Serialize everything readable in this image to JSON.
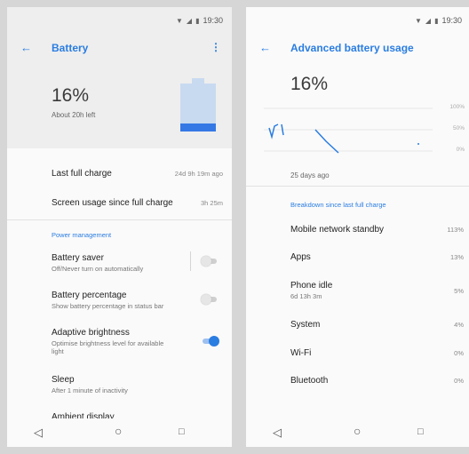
{
  "status": {
    "time": "19:30"
  },
  "left": {
    "title": "Battery",
    "percent": "16%",
    "time_left": "About 20h left",
    "battery_level": 0.16,
    "last_full_charge": {
      "label": "Last full charge",
      "value": "24d 9h 19m ago"
    },
    "screen_usage": {
      "label": "Screen usage since full charge",
      "value": "3h 25m"
    },
    "section": "Power management",
    "battery_saver": {
      "title": "Battery saver",
      "subtitle": "Off/Never turn on automatically"
    },
    "battery_percentage": {
      "title": "Battery percentage",
      "subtitle": "Show battery percentage in status bar"
    },
    "adaptive_brightness": {
      "title": "Adaptive brightness",
      "subtitle_line1": "Optimise brightness level for available",
      "subtitle_line2": "light"
    },
    "sleep": {
      "title": "Sleep",
      "subtitle": "After 1 minute of inactivity"
    },
    "ambient_display": {
      "title": "Ambient display"
    }
  },
  "right": {
    "title": "Advanced battery usage",
    "percent": "16%",
    "chart_caption": "25 days ago",
    "chart_data": {
      "type": "line",
      "ylim": [
        0,
        100
      ],
      "y_ticks": [
        "100%",
        "50%",
        "0%"
      ],
      "xlabel": "25 days ago"
    },
    "section": "Breakdown since last full charge",
    "items": [
      {
        "label": "Mobile network standby",
        "sub": "",
        "value": "113%"
      },
      {
        "label": "Apps",
        "sub": "",
        "value": "13%"
      },
      {
        "label": "Phone idle",
        "sub": "6d 13h 3m",
        "value": "5%"
      },
      {
        "label": "System",
        "sub": "",
        "value": "4%"
      },
      {
        "label": "Wi-Fi",
        "sub": "",
        "value": "0%"
      },
      {
        "label": "Bluetooth",
        "sub": "",
        "value": "0%"
      }
    ]
  },
  "icons": {
    "back": "back-arrow-icon",
    "more": "more-vert-icon",
    "nav_back": "nav-back-icon",
    "nav_home": "nav-home-icon",
    "nav_recents": "nav-recents-icon"
  },
  "colors": {
    "accent": "#2a7de1",
    "battery_fill": "#3478e5",
    "battery_empty": "#c8daf0"
  }
}
